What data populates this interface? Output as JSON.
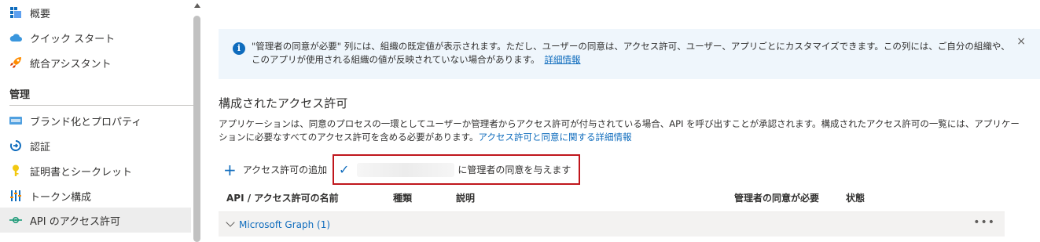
{
  "sidebar": {
    "items": [
      {
        "label": "概要",
        "icon": "overview-grid-icon"
      },
      {
        "label": "クイック スタート",
        "icon": "cloud-icon"
      },
      {
        "label": "統合アシスタント",
        "icon": "rocket-icon"
      }
    ],
    "section_title": "管理",
    "manage_items": [
      {
        "label": "ブランド化とプロパティ",
        "icon": "branding-icon"
      },
      {
        "label": "認証",
        "icon": "authentication-icon"
      },
      {
        "label": "証明書とシークレット",
        "icon": "key-icon"
      },
      {
        "label": "トークン構成",
        "icon": "token-bars-icon"
      },
      {
        "label": "API のアクセス許可",
        "icon": "api-permissions-icon",
        "active": true
      }
    ]
  },
  "banner": {
    "text": "\"管理者の同意が必要\" 列には、組織の既定値が表示されます。ただし、ユーザーの同意は、アクセス許可、ユーザー、アプリごとにカスタマイズできます。この列には、ご自分の組織や、このアプリが使用される組織の値が反映されていない場合があります。",
    "link": "詳細情報",
    "close": "×"
  },
  "main": {
    "heading": "構成されたアクセス許可",
    "description": "アプリケーションは、同意のプロセスの一環としてユーザーか管理者からアクセス許可が付与されている場合、API を呼び出すことが承認されます。構成されたアクセス許可の一覧には、アプリケーションに必要なすべてのアクセス許可を含める必要があります。",
    "description_link": "アクセス許可と同意に関する詳細情報"
  },
  "toolbar": {
    "add_label": "アクセス許可の追加",
    "grant_label": "に管理者の同意を与えます"
  },
  "table": {
    "columns": [
      "API / アクセス許可の名前",
      "種類",
      "説明",
      "管理者の同意が必要",
      "状態"
    ],
    "group_label": "Microsoft Graph (1)",
    "more": "•••"
  },
  "colors": {
    "accent": "#0f6cbd",
    "banner_bg": "#eff6fc",
    "highlight_border": "#c0161c",
    "active_nav_bg": "#ededed"
  }
}
